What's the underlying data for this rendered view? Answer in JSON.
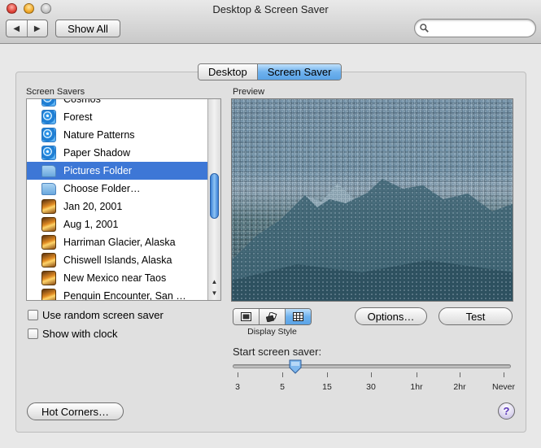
{
  "window": {
    "title": "Desktop & Screen Saver"
  },
  "toolbar": {
    "back_glyph": "◀",
    "forward_glyph": "▶",
    "show_all_label": "Show All",
    "search_value": "",
    "search_placeholder": ""
  },
  "tabs": [
    {
      "label": "Desktop",
      "active": false
    },
    {
      "label": "Screen Saver",
      "active": true
    }
  ],
  "screen_savers": {
    "heading": "Screen Savers",
    "items": [
      {
        "label": "Cosmos",
        "icon": "swirl",
        "selected": false
      },
      {
        "label": "Forest",
        "icon": "swirl",
        "selected": false
      },
      {
        "label": "Nature Patterns",
        "icon": "swirl",
        "selected": false
      },
      {
        "label": "Paper Shadow",
        "icon": "swirl",
        "selected": false
      },
      {
        "label": "Pictures Folder",
        "icon": "folder",
        "selected": true
      },
      {
        "label": "Choose Folder…",
        "icon": "folder",
        "selected": false
      },
      {
        "label": "Jan 20, 2001",
        "icon": "photo",
        "selected": false
      },
      {
        "label": "Aug 1, 2001",
        "icon": "photo",
        "selected": false
      },
      {
        "label": "Harriman Glacier, Alaska",
        "icon": "photo",
        "selected": false
      },
      {
        "label": "Chiswell Islands, Alaska",
        "icon": "photo",
        "selected": false
      },
      {
        "label": "New Mexico near Taos",
        "icon": "photo",
        "selected": false
      },
      {
        "label": "Penguin Encounter, San …",
        "icon": "photo",
        "selected": false
      }
    ]
  },
  "options": {
    "random_label": "Use random screen saver",
    "random_checked": false,
    "clock_label": "Show with clock",
    "clock_checked": false
  },
  "preview": {
    "heading": "Preview",
    "display_style_label": "Display Style",
    "display_styles": [
      {
        "icon": "slideshow-icon",
        "active": false
      },
      {
        "icon": "collage-icon",
        "active": false
      },
      {
        "icon": "mosaic-icon",
        "active": true
      }
    ],
    "options_button": "Options…",
    "test_button": "Test"
  },
  "start_saver": {
    "label": "Start screen saver:",
    "ticks": [
      "3",
      "5",
      "15",
      "30",
      "1hr",
      "2hr",
      "Never"
    ],
    "selected_value": "7"
  },
  "footer": {
    "hot_corners_label": "Hot Corners…",
    "help_glyph": "?"
  }
}
